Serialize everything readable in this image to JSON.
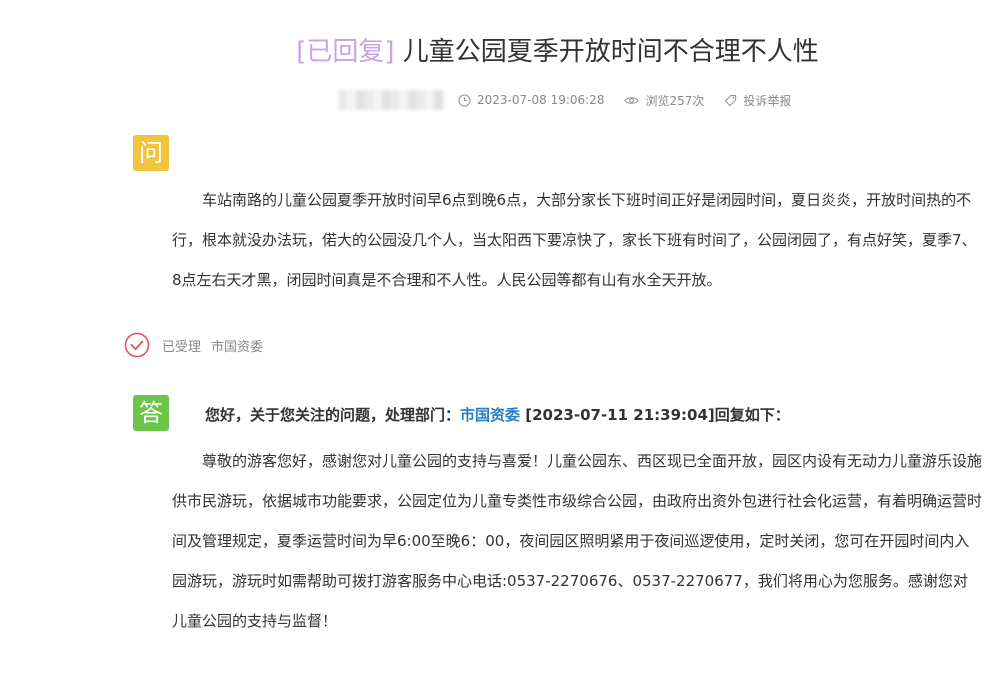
{
  "title": {
    "status_tag": "[已回复]",
    "text": "儿童公园夏季开放时间不合理不人性"
  },
  "meta": {
    "datetime": "2023-07-08 19:06:28",
    "views": "浏览257次",
    "report": "投诉举报"
  },
  "question": {
    "badge": "问",
    "text": "车站南路的儿童公园夏季开放时间早6点到晚6点，大部分家长下班时间正好是闭园时间，夏日炎炎，开放时间热的不行，根本就没办法玩，偌大的公园没几个人，当太阳西下要凉快了，家长下班有时间了，公园闭园了，有点好笑，夏季7、8点左右天才黑，闭园时间真是不合理和不人性。人民公园等都有山有水全天开放。"
  },
  "status": {
    "accepted": "已受理",
    "department": "市国资委"
  },
  "answer": {
    "badge": "答",
    "header_prefix": "您好，关于您关注的问题，处理部门：",
    "header_dept": "市国资委",
    "header_suffix": " [2023-07-11 21:39:04]回复如下：",
    "text": "尊敬的游客您好，感谢您对儿童公园的支持与喜爱！儿童公园东、西区现已全面开放，园区内设有无动力儿童游乐设施供市民游玩，依据城市功能要求，公园定位为儿童专类性市级综合公园，由政府出资外包进行社会化运营，有着明确运营时间及管理规定，夏季运营时间为早6:00至晚6：00，夜间园区照明紧用于夜间巡逻使用，定时关闭，您可在开园时间内入园游玩，游玩时如需帮助可拨打游客服务中心电话:0537-2270676、0537-2270677，我们将用心为您服务。感谢您对儿童公园的支持与监督！"
  },
  "colors": {
    "status_tag": "#c9a3e8",
    "question_badge": "#f3c33b",
    "answer_badge": "#6cc44a",
    "accepted_check": "#e05555",
    "dept_link": "#2a7ec2"
  },
  "icons": {
    "datetime": "clock-icon",
    "views": "eye-icon",
    "report": "tag-icon",
    "accepted": "check-circle-icon"
  }
}
